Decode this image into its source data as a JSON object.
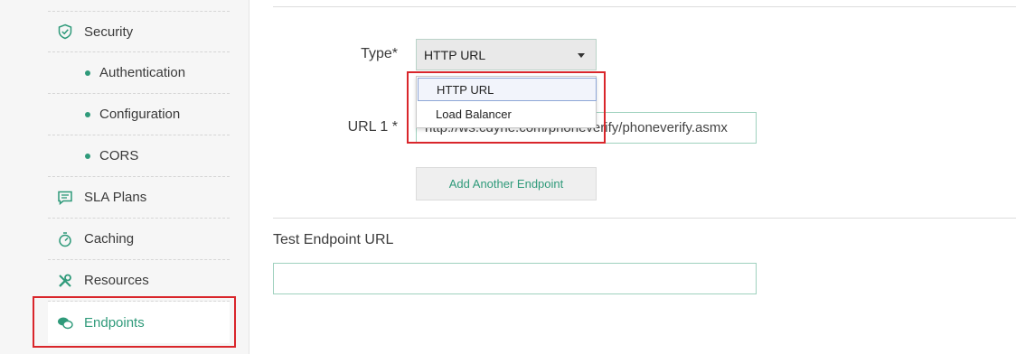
{
  "sidebar": {
    "items": [
      {
        "label": "Security",
        "icon": "shield-check-icon"
      },
      {
        "label": "Authentication"
      },
      {
        "label": "Configuration"
      },
      {
        "label": "CORS"
      },
      {
        "label": "SLA Plans",
        "icon": "chat-list-icon"
      },
      {
        "label": "Caching",
        "icon": "stopwatch-icon"
      },
      {
        "label": "Resources",
        "icon": "tools-icon"
      },
      {
        "label": "Endpoints",
        "icon": "chat-bubbles-icon",
        "active": true
      }
    ]
  },
  "form": {
    "type_label": "Type*",
    "type_value": "HTTP URL",
    "type_options": [
      "HTTP URL",
      "Load Balancer"
    ],
    "url_label": "URL 1 *",
    "url_value": "http://ws.cdyne.com/phoneverify/phoneverify.asmx",
    "add_button": "Add Another Endpoint",
    "test_title": "Test Endpoint URL",
    "test_value": ""
  },
  "colors": {
    "accent": "#2f9a7a",
    "highlight": "#d9262b"
  }
}
